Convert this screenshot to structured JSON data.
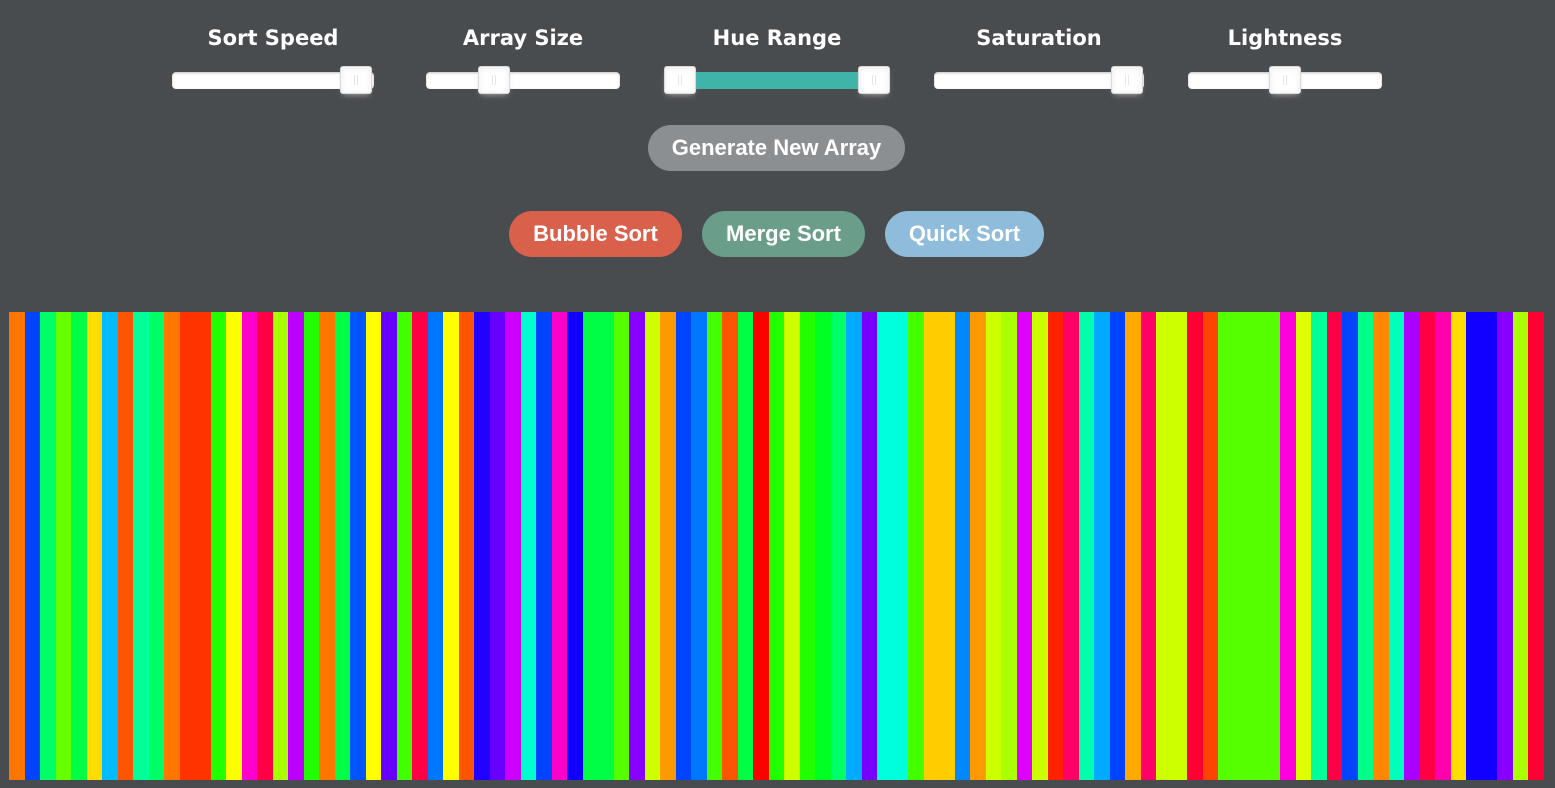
{
  "controls": {
    "sort_speed": {
      "label": "Sort Speed",
      "value": 0.91
    },
    "array_size": {
      "label": "Array Size",
      "value": 0.35
    },
    "hue_range": {
      "label": "Hue Range",
      "low": 0.07,
      "high": 0.93
    },
    "saturation": {
      "label": "Saturation",
      "value": 0.92
    },
    "lightness": {
      "label": "Lightness",
      "value": 0.5
    }
  },
  "buttons": {
    "generate": {
      "label": "Generate New Array",
      "color": "#8c8f91"
    },
    "bubble": {
      "label": "Bubble Sort",
      "color": "#d9604b"
    },
    "merge": {
      "label": "Merge Sort",
      "color": "#6a9e8a"
    },
    "quick": {
      "label": "Quick Sort",
      "color": "#8fbcda"
    }
  },
  "array_colors": [
    "#ff7700",
    "#0044ff",
    "#00ff66",
    "#66ff00",
    "#00ff44",
    "#ffdd00",
    "#00bbff",
    "#ff5500",
    "#00ff99",
    "#00ff66",
    "#ff7700",
    "#ff3300",
    "#ff3300",
    "#22ff00",
    "#ffff00",
    "#ff00cc",
    "#ff0044",
    "#aaff00",
    "#bb00ff",
    "#22ff00",
    "#ff7700",
    "#00ff44",
    "#0055ff",
    "#ffff00",
    "#6600ff",
    "#44ff00",
    "#ff0044",
    "#0077ff",
    "#ffff00",
    "#ff5500",
    "#2200ff",
    "#6600ff",
    "#cc00ff",
    "#00ffcc",
    "#0044ff",
    "#ff00cc",
    "#1100ff",
    "#00ff44",
    "#00ff44",
    "#55ff00",
    "#8800ff",
    "#ccff00",
    "#ff9900",
    "#0044ff",
    "#0077ff",
    "#44ff00",
    "#ff5500",
    "#00ff44",
    "#ff0000",
    "#22ff00",
    "#ccff00",
    "#22ff00",
    "#00ff22",
    "#00ff66",
    "#00aaff",
    "#7700ff",
    "#00ffdd",
    "#00ffdd",
    "#44ff00",
    "#ffcc00",
    "#ffcc00",
    "#0088ff",
    "#ff9900",
    "#ccff00",
    "#aaff00",
    "#dd00ff",
    "#ccff00",
    "#ff2200",
    "#ff0066",
    "#00ffaa",
    "#00aaff",
    "#0044ff",
    "#ffaa00",
    "#ff0066",
    "#ccff00",
    "#ccff00",
    "#ff0033",
    "#ff4400",
    "#55ff00",
    "#55ff00",
    "#55ff00",
    "#55ff00",
    "#ff00dd",
    "#ddff00",
    "#00ff99",
    "#ff0044",
    "#0044ff",
    "#00ff88",
    "#ff8800",
    "#00ffbb",
    "#aa00ff",
    "#ff0044",
    "#ff00aa",
    "#ffdd00",
    "#1100ff",
    "#1100ff",
    "#8800ff",
    "#aaff00",
    "#ff0033"
  ]
}
